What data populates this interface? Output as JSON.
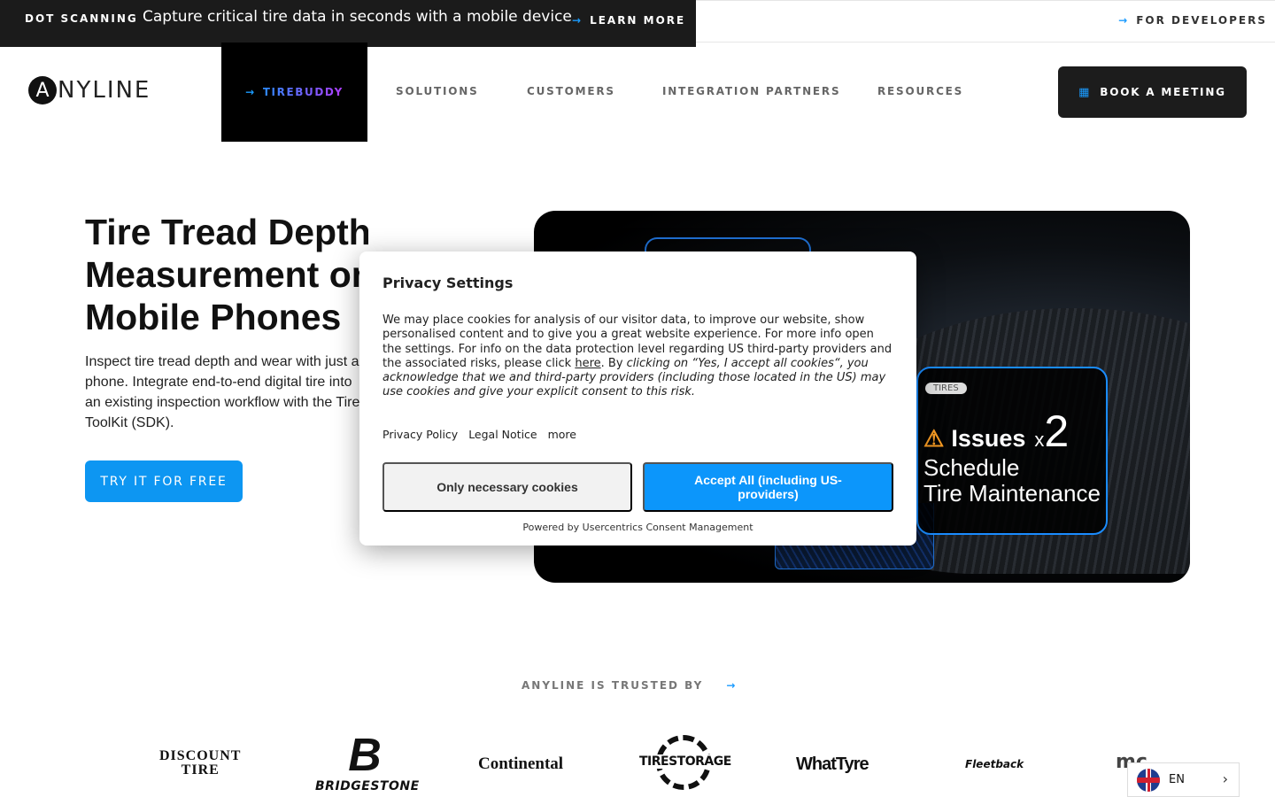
{
  "announcement": {
    "tag": "DOT SCANNING",
    "message": "Capture critical tire data in seconds with a mobile device",
    "link": "LEARN MORE",
    "developers": "FOR DEVELOPERS"
  },
  "nav": {
    "logo_letter": "A",
    "logo_word": "NYLINE",
    "active_item": "TIREBUDDY",
    "items": [
      "SOLUTIONS",
      "CUSTOMERS",
      "INTEGRATION PARTNERS",
      "RESOURCES"
    ],
    "cta": "BOOK A MEETING"
  },
  "hero": {
    "title_lines": [
      "Tire Tread Depth",
      "Measurement on",
      "Mobile Phones"
    ],
    "text": "Inspect tire tread depth and wear with just a phone. Integrate end-to-end digital tire into an existing inspection workflow with the Tire ToolKit (SDK).",
    "cta": "TRY IT FOR FREE",
    "card": {
      "chip": "TIRES",
      "issues": "Issues",
      "times": "x",
      "count": "2",
      "schedule_line1": "Schedule",
      "schedule_line2": "Tire Maintenance"
    }
  },
  "trusted": {
    "label": "ANYLINE IS TRUSTED BY",
    "brands": {
      "discount_1": "DISCOUNT",
      "discount_2": "TIRE",
      "bridgestone_mark": "B",
      "bridgestone": "BRIDGESTONE",
      "continental": "Continental",
      "tirestorage": "TIRESTORAGE",
      "whattyre": "WhatTyre",
      "fleetback": "Fleetback",
      "mc": "mc"
    }
  },
  "language": {
    "code": "EN"
  },
  "modal": {
    "title": "Privacy Settings",
    "body_plain": "We may place cookies for analysis of our visitor data, to improve our website, show personalised content and to give you a great website experience. For more info open the settings. For info on the data protection level regarding US third-party providers and the associated risks, please click ",
    "body_link": "here",
    "body_sep": ". By ",
    "body_italic": "clicking on “Yes, I accept all cookies“, you acknowledge that we and third-party providers (including those located in the US) may use cookies and give your explicit consent to this risk.",
    "links": [
      "Privacy Policy",
      "Legal Notice",
      "more"
    ],
    "btn_necessary": "Only necessary cookies",
    "btn_accept": "Accept All (including US-providers)",
    "powered": "Powered by Usercentrics Consent Management"
  },
  "colors": {
    "accent": "#0c96fb",
    "dark": "#1b1b1b"
  }
}
